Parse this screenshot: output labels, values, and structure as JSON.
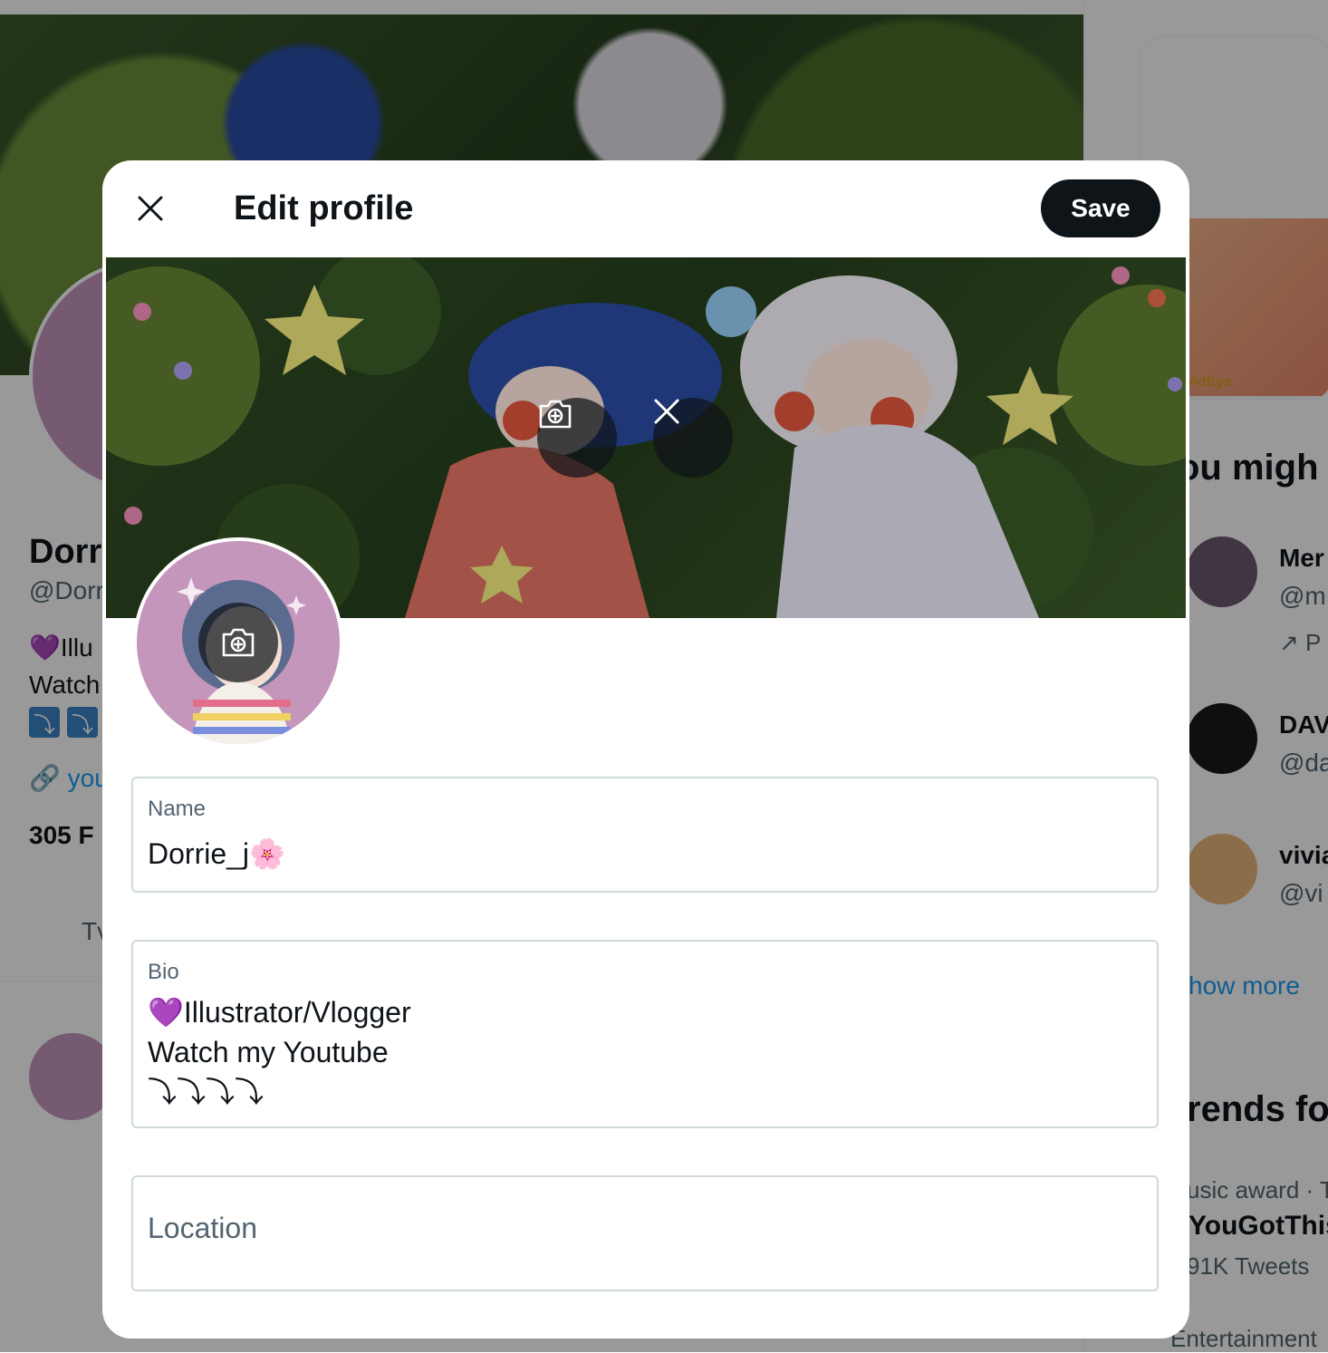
{
  "background": {
    "profile": {
      "name_fragment": "Dorr",
      "handle_fragment": "@Dorr",
      "bio_line1": "💜Illu",
      "bio_line2": "Watch",
      "arrows": [
        "⤵",
        "⤵"
      ],
      "link_fragment": "you",
      "followers_fragment": "305 F",
      "tab_fragment": "Tv"
    },
    "sidebar": {
      "media_tag": "#dtiys",
      "who_to_follow_fragment": "ou migh",
      "users": [
        {
          "name": "Mer",
          "handle": "@m",
          "extra": "P"
        },
        {
          "name": "DAV",
          "handle": "@da"
        },
        {
          "name": "vivia",
          "handle": "@vi"
        }
      ],
      "show_more_fragment": "how more",
      "trends_fragment": "rends fo",
      "trend": {
        "meta": "usic award · T",
        "name": "YouGotThis",
        "count": "91K Tweets"
      },
      "trend2_meta": "Entertainment"
    }
  },
  "modal": {
    "title": "Edit profile",
    "save_label": "Save",
    "icons": {
      "close": "close-icon",
      "banner_camera": "camera-add-icon",
      "banner_remove": "remove-icon",
      "avatar_camera": "camera-add-icon"
    },
    "fields": {
      "name": {
        "label": "Name",
        "value": "Dorrie_j🌸"
      },
      "bio": {
        "label": "Bio",
        "lines": [
          "💜Illustrator/Vlogger",
          "Watch my Youtube",
          "⤵⤵⤵⤵"
        ]
      },
      "location": {
        "placeholder": "Location",
        "value": ""
      }
    }
  },
  "colors": {
    "accent": "#1d9bf0",
    "save_bg": "#0f1419",
    "avatar_bg": "#c596bc",
    "field_border": "#cfd9de"
  }
}
